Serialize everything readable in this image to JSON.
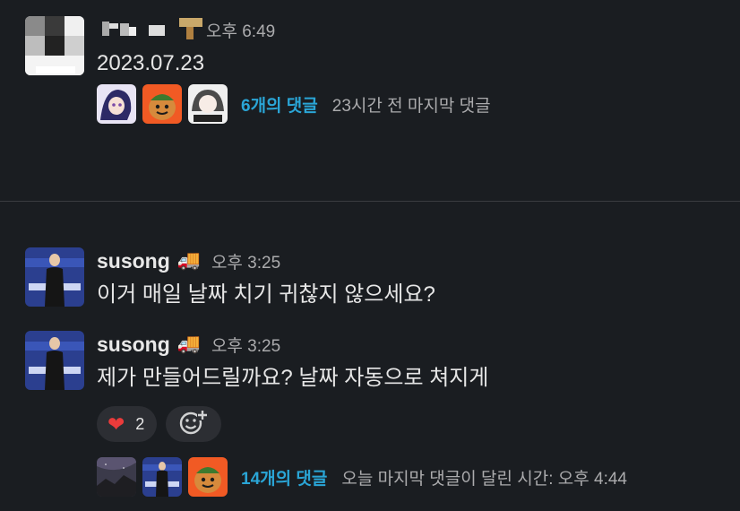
{
  "messages": [
    {
      "author": "",
      "author_blurred": true,
      "time": "오후 6:49",
      "text": "2023.07.23",
      "thread": {
        "count_label": "6개의 댓글",
        "meta": "23시간 전 마지막 댓글"
      }
    },
    {
      "author": "susong",
      "emoji": "🚚",
      "time": "오후 3:25",
      "text": "이거 매일 날짜 치기 귀찮지 않으세요?"
    },
    {
      "author": "susong",
      "emoji": "🚚",
      "time": "오후 3:25",
      "text": "제가 만들어드릴까요? 날짜 자동으로 쳐지게",
      "reactions": [
        {
          "icon": "heart",
          "count": "2"
        }
      ],
      "thread": {
        "count_label": "14개의 댓글",
        "meta": "오늘 마지막 댓글이 달린 시간: 오후 4:44"
      }
    }
  ],
  "colors": {
    "background": "#1a1d21",
    "link": "#2aa5d6",
    "muted": "#ababad",
    "reaction_bg": "#2c2e33"
  }
}
